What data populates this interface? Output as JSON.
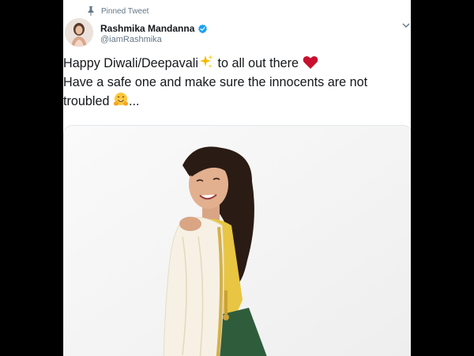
{
  "pinned_label": "Pinned Tweet",
  "user": {
    "display_name": "Rashmika Mandanna",
    "handle": "@iamRashmika",
    "verified": true
  },
  "tweet": {
    "line1_before": "Happy Diwali/Deepavali",
    "line1_after": " to all out there ",
    "line2": "Have a safe one and make sure the innocents are not",
    "line3_before": "troubled ",
    "line3_after": "..."
  },
  "icons": {
    "pin": "pin-icon",
    "verified": "verified-badge-icon",
    "caret": "chevron-down-icon",
    "sparkles": "sparkles-emoji",
    "heart": "red-heart-emoji",
    "hug": "hugging-face-emoji"
  },
  "colors": {
    "verified_blue": "#1da1f2",
    "secondary_text": "#657786",
    "primary_text": "#14171a",
    "heart_red": "#c8102e"
  }
}
